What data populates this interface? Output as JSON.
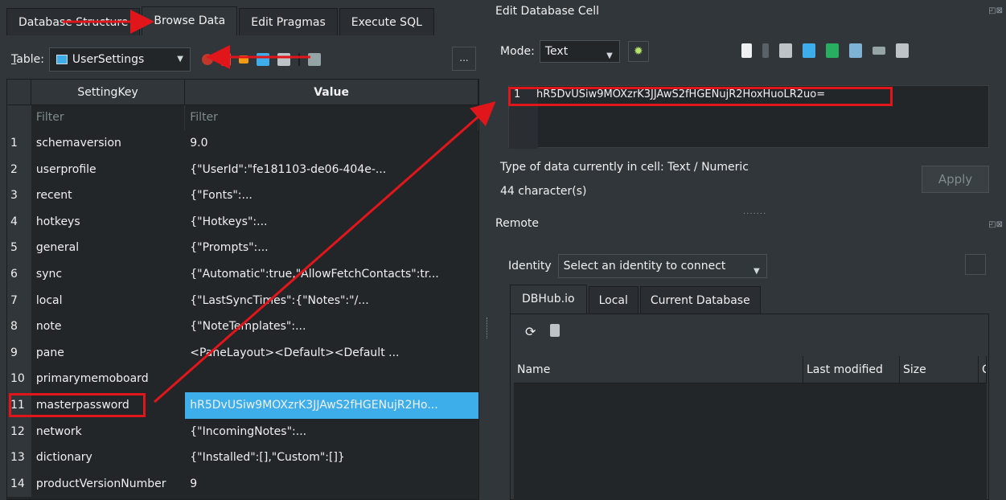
{
  "left": {
    "tabs": [
      "Database Structure",
      "Browse Data",
      "Edit Pragmas",
      "Execute SQL"
    ],
    "table_label_prefix": "T",
    "table_label_rest": "able:",
    "table_name": "UserSettings",
    "more_label": "...",
    "columns": [
      "SettingKey",
      "Value"
    ],
    "filter_placeholder": "Filter",
    "rows": [
      {
        "n": "1",
        "key": "schemaversion",
        "value": "9.0"
      },
      {
        "n": "2",
        "key": "userprofile",
        "value": "{\"UserId\":\"fe181103-de06-404e-..."
      },
      {
        "n": "3",
        "key": "recent",
        "value": "{\"Fonts\":..."
      },
      {
        "n": "4",
        "key": "hotkeys",
        "value": "{\"Hotkeys\":..."
      },
      {
        "n": "5",
        "key": "general",
        "value": "{\"Prompts\":..."
      },
      {
        "n": "6",
        "key": "sync",
        "value": "{\"Automatic\":true,\"AllowFetchContacts\":tr..."
      },
      {
        "n": "7",
        "key": "local",
        "value": "{\"LastSyncTimes\":{\"Notes\":\"/..."
      },
      {
        "n": "8",
        "key": "note",
        "value": "{\"NoteTemplates\":..."
      },
      {
        "n": "9",
        "key": "pane",
        "value": "<PaneLayout><Default><Default ..."
      },
      {
        "n": "10",
        "key": "primarymemoboard",
        "value": ""
      },
      {
        "n": "11",
        "key": "masterpassword",
        "value": "hR5DvUSiw9MOXzrK3JJAwS2fHGENujR2Ho..."
      },
      {
        "n": "12",
        "key": "network",
        "value": "{\"IncomingNotes\":..."
      },
      {
        "n": "13",
        "key": "dictionary",
        "value": "{\"Installed\":[],\"Custom\":[]}"
      },
      {
        "n": "14",
        "key": "productVersionNumber",
        "value": "9"
      }
    ]
  },
  "editor": {
    "title": "Edit Database Cell",
    "mode_label": "Mode:",
    "mode_value": "Text",
    "line_number": "1",
    "cell_text": "hR5DvUSiw9MOXzrK3JJAwS2fHGENujR2HoxHuoLR2uo=",
    "type_info": "Type of data currently in cell: Text / Numeric",
    "char_count": "44 character(s)",
    "apply_label": "Apply"
  },
  "remote": {
    "title": "Remote",
    "identity_label": "Identity",
    "identity_placeholder": "Select an identity to connect",
    "tabs": [
      "DBHub.io",
      "Local",
      "Current Database"
    ],
    "columns": [
      "Name",
      "Last modified",
      "Size",
      "C"
    ]
  },
  "icons": {
    "table": "table-icon",
    "gear": "gear-icon",
    "refresh": "refresh-icon",
    "database": "database-icon",
    "print": "print-icon"
  },
  "colors": {
    "background": "#31363b",
    "grid_background": "#232629",
    "selection": "#3daee9",
    "annotation": "#e0161b"
  }
}
